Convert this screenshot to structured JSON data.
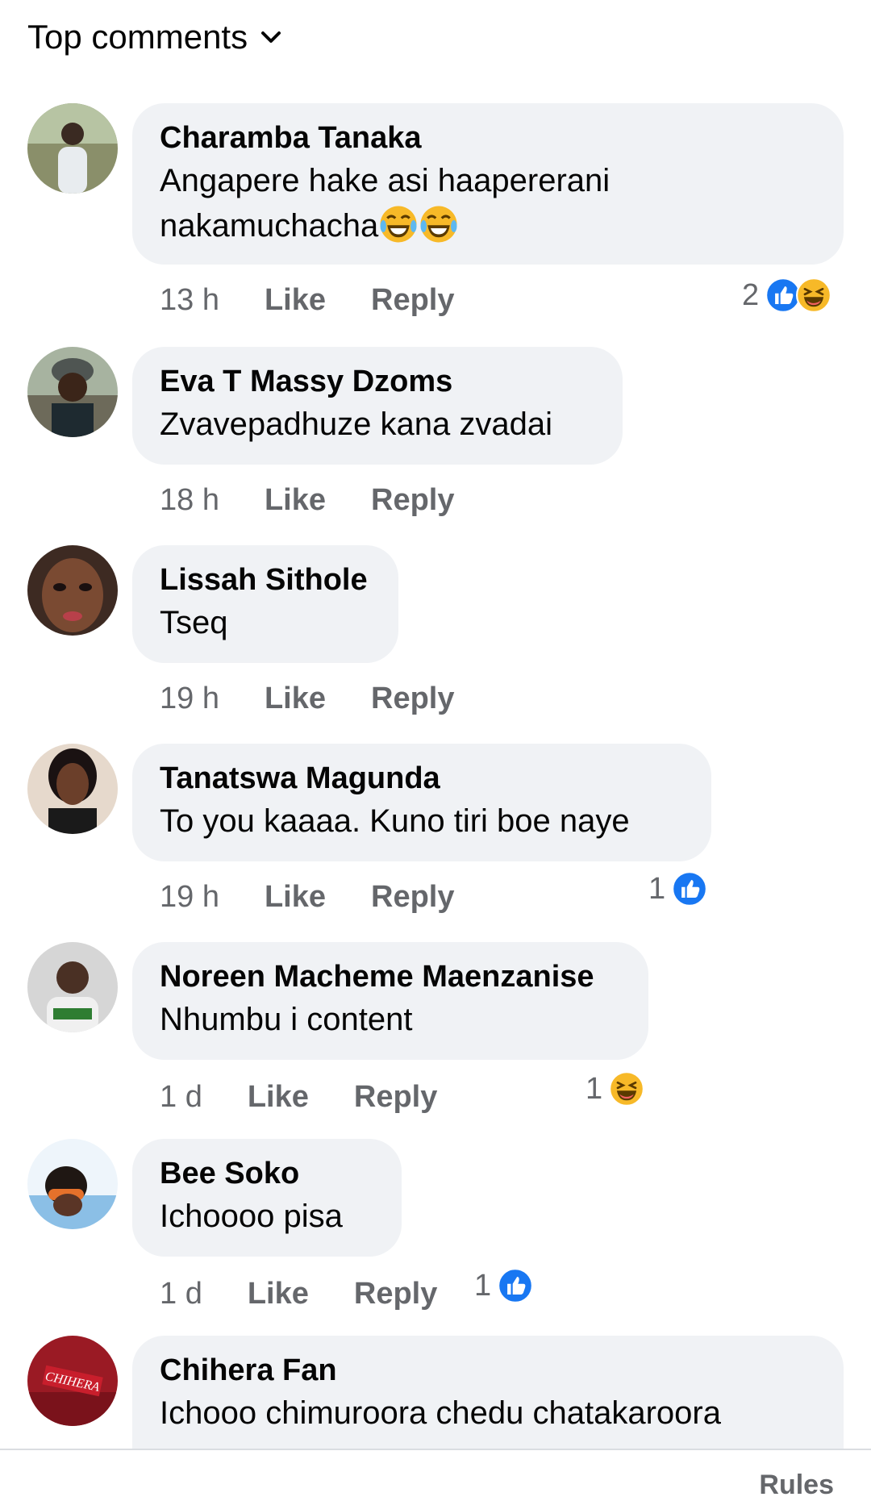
{
  "header": {
    "label": "Top comments"
  },
  "comments": [
    {
      "author": "Charamba Tanaka",
      "text_line1": "Angapere hake asi haapererani",
      "text_line2": "nakamuchacha",
      "time": "13 h",
      "like": "Like",
      "reply": "Reply",
      "reaction_count": "2",
      "reactions": [
        "like-icon",
        "laugh-icon"
      ]
    },
    {
      "author": "Eva T Massy Dzoms",
      "text": "Zvavepadhuze kana zvadai",
      "time": "18 h",
      "like": "Like",
      "reply": "Reply"
    },
    {
      "author": "Lissah Sithole",
      "text": "Tseq",
      "time": "19 h",
      "like": "Like",
      "reply": "Reply"
    },
    {
      "author": "Tanatswa Magunda",
      "text": "To you kaaaa. Kuno tiri boe naye",
      "time": "19 h",
      "like": "Like",
      "reply": "Reply",
      "reaction_count": "1",
      "reactions": [
        "like-icon"
      ]
    },
    {
      "author": "Noreen Macheme Maenzanise",
      "text": "Nhumbu i content",
      "time": "1 d",
      "like": "Like",
      "reply": "Reply",
      "reaction_count": "1",
      "reactions": [
        "laugh-icon"
      ]
    },
    {
      "author": "Bee Soko",
      "text": "Ichoooo pisa",
      "time": "1 d",
      "like": "Like",
      "reply": "Reply",
      "reaction_count": "1",
      "reactions": [
        "like-icon"
      ]
    },
    {
      "author": "Chihera Fan",
      "text": "Ichooo chimuroora chedu chatakaroora"
    }
  ],
  "avatar_badge_text": "CHIHERA",
  "footer": {
    "rules": "Rules"
  },
  "colors": {
    "bubble": "#f0f2f5",
    "like_blue": "#1877f2",
    "secondary_text": "#65676b",
    "laugh_yellow": "#f7b928"
  }
}
